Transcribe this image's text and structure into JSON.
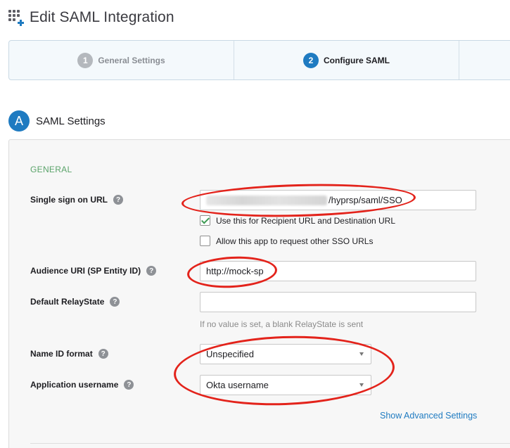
{
  "page": {
    "title": "Edit SAML Integration"
  },
  "wizard": {
    "steps": [
      {
        "number": "1",
        "label": "General Settings"
      },
      {
        "number": "2",
        "label": "Configure SAML"
      }
    ]
  },
  "section": {
    "badge": "A",
    "title": "SAML Settings"
  },
  "form": {
    "group_heading": "GENERAL",
    "sso_url": {
      "label": "Single sign on URL",
      "value_suffix": "/hyprsp/saml/SSO"
    },
    "use_recipient_checkbox": {
      "label": "Use this for Recipient URL and Destination URL",
      "checked": true
    },
    "allow_other_sso_checkbox": {
      "label": "Allow this app to request other SSO URLs",
      "checked": false
    },
    "audience_uri": {
      "label": "Audience URI (SP Entity ID)",
      "value": "http://mock-sp"
    },
    "relay_state": {
      "label": "Default RelayState",
      "value": "",
      "hint": "If no value is set, a blank RelayState is sent"
    },
    "name_id_format": {
      "label": "Name ID format",
      "selected": "Unspecified"
    },
    "app_username": {
      "label": "Application username",
      "selected": "Okta username"
    },
    "advanced_link": "Show Advanced Settings",
    "help_glyph": "?"
  },
  "colors": {
    "accent": "#1f7bc1",
    "annotation": "#e3231b",
    "group_heading": "#5aa36a"
  }
}
